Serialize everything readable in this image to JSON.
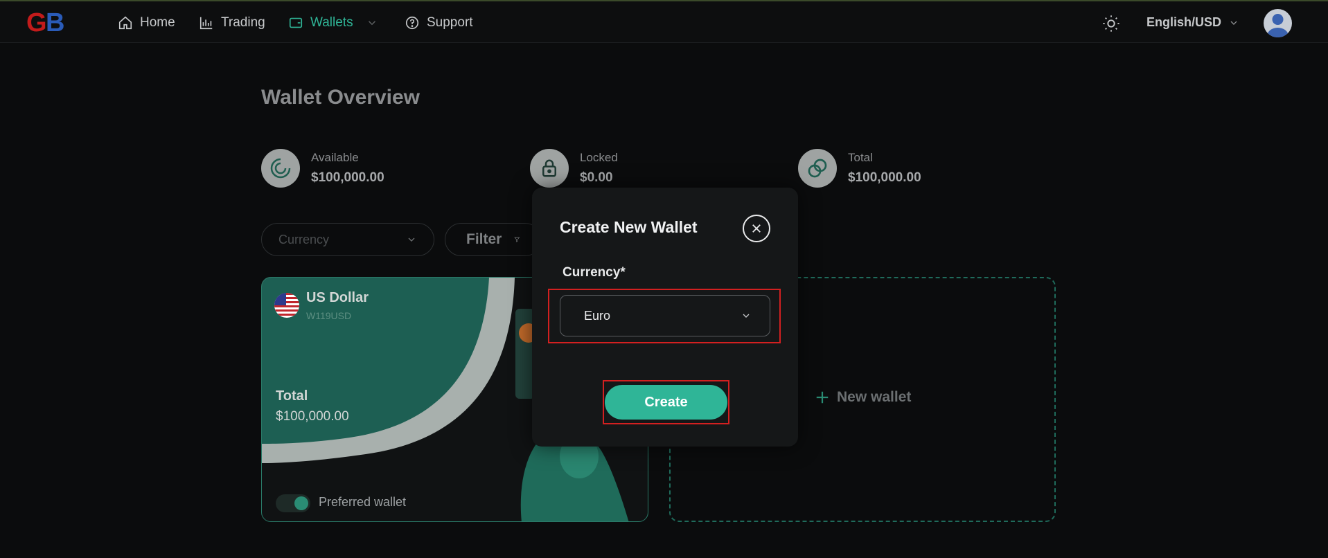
{
  "nav": {
    "logo_text": "GB",
    "home": "Home",
    "trading": "Trading",
    "wallets": "Wallets",
    "support": "Support",
    "language": "English/USD"
  },
  "overview": {
    "title": "Wallet Overview",
    "available_label": "Available",
    "available_value": "$100,000.00",
    "locked_label": "Locked",
    "locked_value": "$0.00",
    "total_label": "Total",
    "total_value": "$100,000.00"
  },
  "filters": {
    "currency_placeholder": "Currency",
    "filter_label": "Filter"
  },
  "wallet_card": {
    "name": "US Dollar",
    "code": "W119USD",
    "total_label": "Total",
    "total_value": "$100,000.00",
    "preferred_label": "Preferred wallet",
    "preferred_on": true
  },
  "new_wallet": {
    "label": "New wallet"
  },
  "modal": {
    "title": "Create New Wallet",
    "currency_label": "Currency*",
    "currency_value": "Euro",
    "create_label": "Create"
  },
  "colors": {
    "accent": "#2fb597",
    "highlight": "#d32020",
    "background": "#0b0c0d"
  },
  "icons": [
    "home-icon",
    "chart-icon",
    "wallet-icon",
    "help-icon",
    "sun-icon",
    "chevron-down-icon",
    "user-icon",
    "available-icon",
    "lock-icon",
    "coins-icon",
    "filter-icon",
    "us-flag-icon",
    "plus-icon",
    "close-icon"
  ]
}
